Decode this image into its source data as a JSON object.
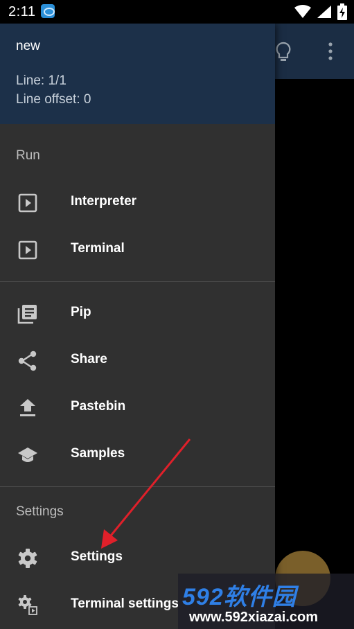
{
  "status_bar": {
    "time": "2:11",
    "icons": [
      "app-notification-icon",
      "wifi-icon",
      "cellular-signal-icon",
      "battery-charging-icon"
    ]
  },
  "drawer": {
    "header": {
      "filename": "new",
      "line": "Line: 1/1",
      "offset": "Line offset: 0"
    },
    "sections": {
      "run": {
        "title": "Run"
      },
      "settings": {
        "title": "Settings"
      }
    },
    "items": {
      "interpreter": {
        "label": "Interpreter",
        "icon": "play-box-icon"
      },
      "terminal": {
        "label": "Terminal",
        "icon": "play-box-icon"
      },
      "pip": {
        "label": "Pip",
        "icon": "library-books-icon"
      },
      "share": {
        "label": "Share",
        "icon": "share-icon"
      },
      "pastebin": {
        "label": "Pastebin",
        "icon": "upload-icon"
      },
      "samples": {
        "label": "Samples",
        "icon": "school-icon"
      },
      "settings": {
        "label": "Settings",
        "icon": "gear-icon"
      },
      "terminal_settings": {
        "label": "Terminal settings",
        "icon": "gear-play-icon"
      }
    }
  },
  "toolbar": {
    "icons": [
      "lightbulb-icon",
      "more-vert-icon"
    ]
  },
  "watermark": {
    "brand": "592软件园",
    "url": "www.592xiazai.com"
  },
  "colors": {
    "drawer_bg": "#303030",
    "header_bg": "#1c3049",
    "toolbar_bg": "#1b2d44",
    "annotation_arrow": "#e0202a",
    "watermark_brand": "#2f7fe6"
  }
}
